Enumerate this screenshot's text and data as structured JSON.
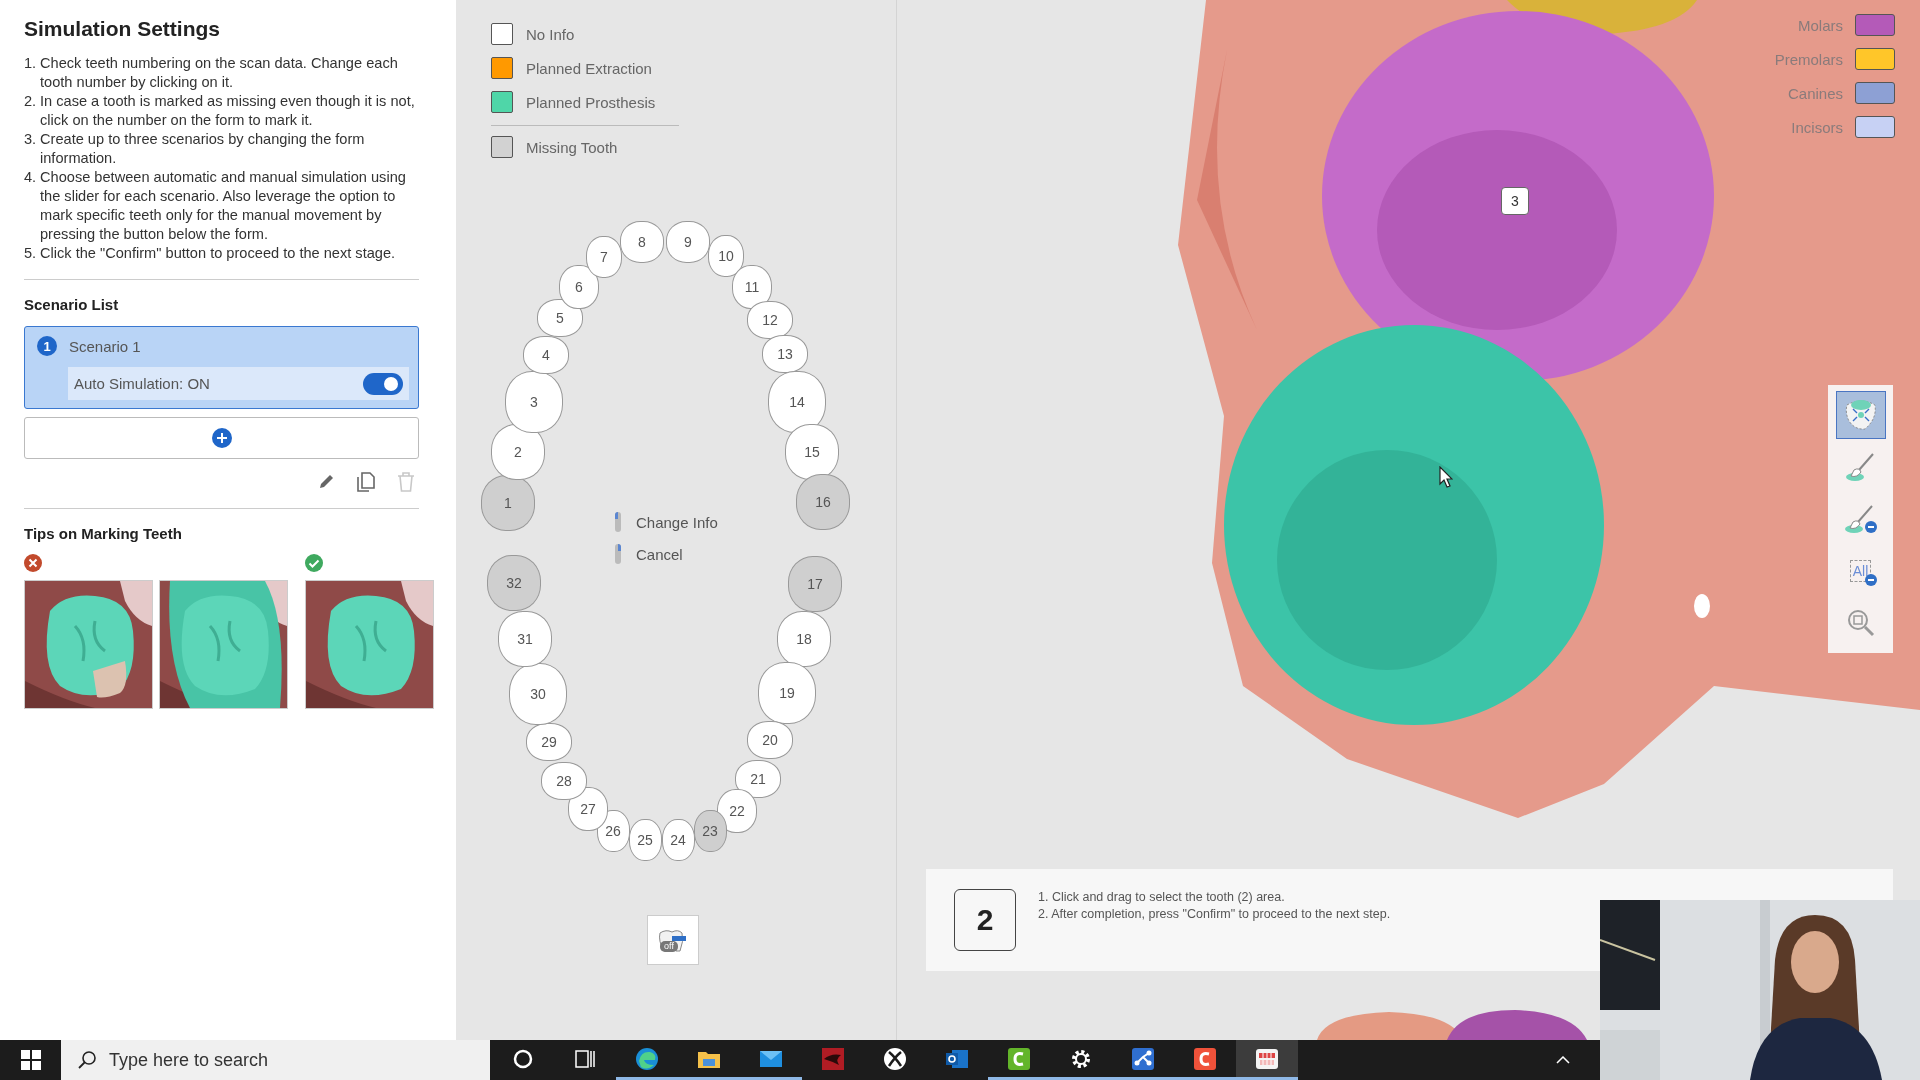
{
  "left_panel": {
    "title": "Simulation Settings",
    "instructions": [
      {
        "number": "1.",
        "text": "Check teeth numbering on the scan data. Change each tooth number by clicking on it."
      },
      {
        "number": "2.",
        "text": "In case a tooth is marked as missing even though it is not, click on the number on the form to mark it."
      },
      {
        "number": "3.",
        "text": "Create up to three scenarios by changing the form information."
      },
      {
        "number": "4.",
        "text": "Choose between automatic and manual simulation using the slider for each scenario. Also leverage the option to mark specific teeth only for the manual movement by pressing the button below the form."
      },
      {
        "number": "5.",
        "text": "Click the \"Confirm\" button to proceed to the next stage."
      }
    ],
    "scenario_list": {
      "title": "Scenario List",
      "scenarios": [
        {
          "number": "1",
          "name": "Scenario 1",
          "selected": true,
          "auto_simulation": {
            "label": "Auto Simulation: ON",
            "on": true
          }
        }
      ],
      "actions": [
        {
          "kind": "edit",
          "disabled": false
        },
        {
          "kind": "copy",
          "disabled": false
        },
        {
          "kind": "delete",
          "disabled": true
        }
      ]
    },
    "tips": {
      "title": "Tips on Marking Teeth",
      "groups": [
        {
          "kind": "incorrect"
        },
        {
          "kind": "correct"
        }
      ]
    }
  },
  "chart_panel": {
    "status_legend": [
      {
        "label": "No Info",
        "color": "#ffffff"
      },
      {
        "label": "Planned Extraction",
        "color": "#ff9900"
      },
      {
        "label": "Planned Prosthesis",
        "color": "#4fd6a8"
      }
    ],
    "missing_legend": {
      "label": "Missing Tooth",
      "color": "#d2d2d2"
    },
    "teeth": [
      {
        "number": "1",
        "missing": true
      },
      {
        "number": "2",
        "missing": false
      },
      {
        "number": "3",
        "missing": false
      },
      {
        "number": "4",
        "missing": false
      },
      {
        "number": "5",
        "missing": false
      },
      {
        "number": "6",
        "missing": false
      },
      {
        "number": "7",
        "missing": false
      },
      {
        "number": "8",
        "missing": false
      },
      {
        "number": "9",
        "missing": false
      },
      {
        "number": "10",
        "missing": false
      },
      {
        "number": "11",
        "missing": false
      },
      {
        "number": "12",
        "missing": false
      },
      {
        "number": "13",
        "missing": false
      },
      {
        "number": "14",
        "missing": false
      },
      {
        "number": "15",
        "missing": false
      },
      {
        "number": "16",
        "missing": true
      },
      {
        "number": "17",
        "missing": true
      },
      {
        "number": "18",
        "missing": false
      },
      {
        "number": "19",
        "missing": false
      },
      {
        "number": "20",
        "missing": false
      },
      {
        "number": "21",
        "missing": false
      },
      {
        "number": "22",
        "missing": false
      },
      {
        "number": "23",
        "missing": true
      },
      {
        "number": "24",
        "missing": false
      },
      {
        "number": "25",
        "missing": false
      },
      {
        "number": "26",
        "missing": false
      },
      {
        "number": "27",
        "missing": false
      },
      {
        "number": "28",
        "missing": false
      },
      {
        "number": "29",
        "missing": false
      },
      {
        "number": "30",
        "missing": false
      },
      {
        "number": "31",
        "missing": false
      },
      {
        "number": "32",
        "missing": true
      }
    ],
    "mouse_hints": [
      {
        "kind": "left",
        "label": "Change Info"
      },
      {
        "kind": "right",
        "label": "Cancel"
      }
    ],
    "manual_marking": {
      "label": "off",
      "on": false
    }
  },
  "scan_view": {
    "type_legend": [
      {
        "label": "Molars",
        "color": "#b45ab8"
      },
      {
        "label": "Premolars",
        "color": "#ffc629"
      },
      {
        "label": "Canines",
        "color": "#8da0d4"
      },
      {
        "label": "Incisors",
        "color": "#c7d1f4"
      }
    ],
    "tooth_label": "3",
    "tools": [
      {
        "kind": "fit",
        "selected": true
      },
      {
        "kind": "brush",
        "selected": false
      },
      {
        "kind": "brush_erase",
        "selected": false
      },
      {
        "kind": "clear_all",
        "label": "All",
        "selected": false
      },
      {
        "kind": "zoom",
        "selected": false
      }
    ],
    "guide": {
      "step": "2",
      "lines": [
        "1. Click and drag to select the tooth (2) area.",
        "2. After completion, press \"Confirm\" to proceed to the next step."
      ]
    }
  },
  "taskbar": {
    "search": {
      "placeholder": "Type here to search"
    },
    "apps": [
      {
        "kind": "cortana",
        "running": false,
        "active": false
      },
      {
        "kind": "taskview",
        "running": false,
        "active": false
      },
      {
        "kind": "browser",
        "running": true,
        "active": false
      },
      {
        "kind": "folder",
        "running": true,
        "active": false
      },
      {
        "kind": "mail",
        "running": true,
        "active": false
      },
      {
        "kind": "red_app",
        "running": false,
        "active": false
      },
      {
        "kind": "xbox",
        "running": false,
        "active": false
      },
      {
        "kind": "outlook",
        "running": false,
        "active": false
      },
      {
        "kind": "green_app",
        "running": true,
        "active": false
      },
      {
        "kind": "settings",
        "running": true,
        "active": false
      },
      {
        "kind": "blue_app",
        "running": true,
        "active": false
      },
      {
        "kind": "orange_app",
        "running": true,
        "active": false
      },
      {
        "kind": "dental_app",
        "running": true,
        "active": true
      }
    ]
  }
}
